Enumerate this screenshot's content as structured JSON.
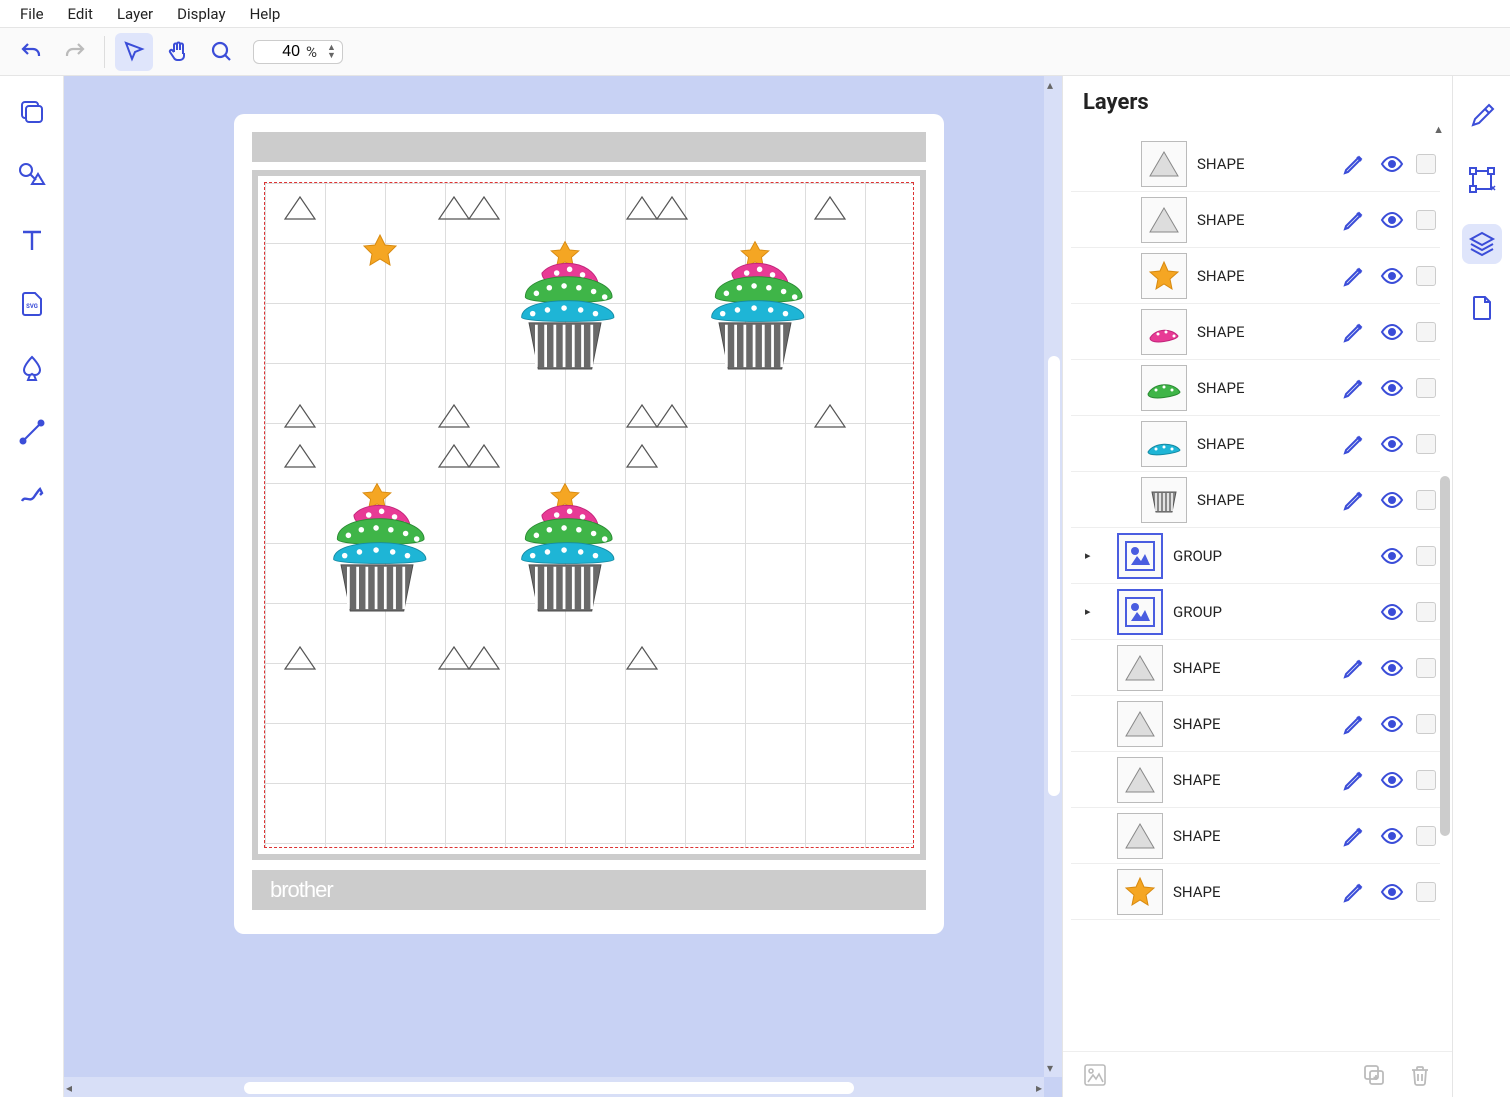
{
  "menu": {
    "items": [
      "File",
      "Edit",
      "Layer",
      "Display",
      "Help"
    ]
  },
  "toolbar": {
    "zoom_value": "40",
    "zoom_unit": "%"
  },
  "panel": {
    "title": "Layers"
  },
  "layers": [
    {
      "name": "SHAPE",
      "type": "shape",
      "thumb": "triangle",
      "indent": 1
    },
    {
      "name": "SHAPE",
      "type": "shape",
      "thumb": "triangle",
      "indent": 1
    },
    {
      "name": "SHAPE",
      "type": "shape",
      "thumb": "star",
      "indent": 1
    },
    {
      "name": "SHAPE",
      "type": "shape",
      "thumb": "swirl-pink",
      "indent": 1
    },
    {
      "name": "SHAPE",
      "type": "shape",
      "thumb": "swirl-green",
      "indent": 1
    },
    {
      "name": "SHAPE",
      "type": "shape",
      "thumb": "swirl-cyan",
      "indent": 1
    },
    {
      "name": "SHAPE",
      "type": "shape",
      "thumb": "wrapper",
      "indent": 1
    },
    {
      "name": "GROUP",
      "type": "group",
      "thumb": "group",
      "indent": 0
    },
    {
      "name": "GROUP",
      "type": "group",
      "thumb": "group",
      "indent": 0
    },
    {
      "name": "SHAPE",
      "type": "shape",
      "thumb": "triangle",
      "indent": 0
    },
    {
      "name": "SHAPE",
      "type": "shape",
      "thumb": "triangle",
      "indent": 0
    },
    {
      "name": "SHAPE",
      "type": "shape",
      "thumb": "triangle",
      "indent": 0
    },
    {
      "name": "SHAPE",
      "type": "shape",
      "thumb": "triangle",
      "indent": 0
    },
    {
      "name": "SHAPE",
      "type": "shape",
      "thumb": "star",
      "indent": 0
    }
  ],
  "brand": {
    "logo_text": "brother"
  },
  "colors": {
    "primary": "#3b4dd8",
    "canvas_bg": "#c8d2f4",
    "star": "#f5a623",
    "pink": "#e83a95",
    "green": "#3fb548",
    "cyan": "#1eb5d6",
    "gray": "#6a6a6a"
  }
}
